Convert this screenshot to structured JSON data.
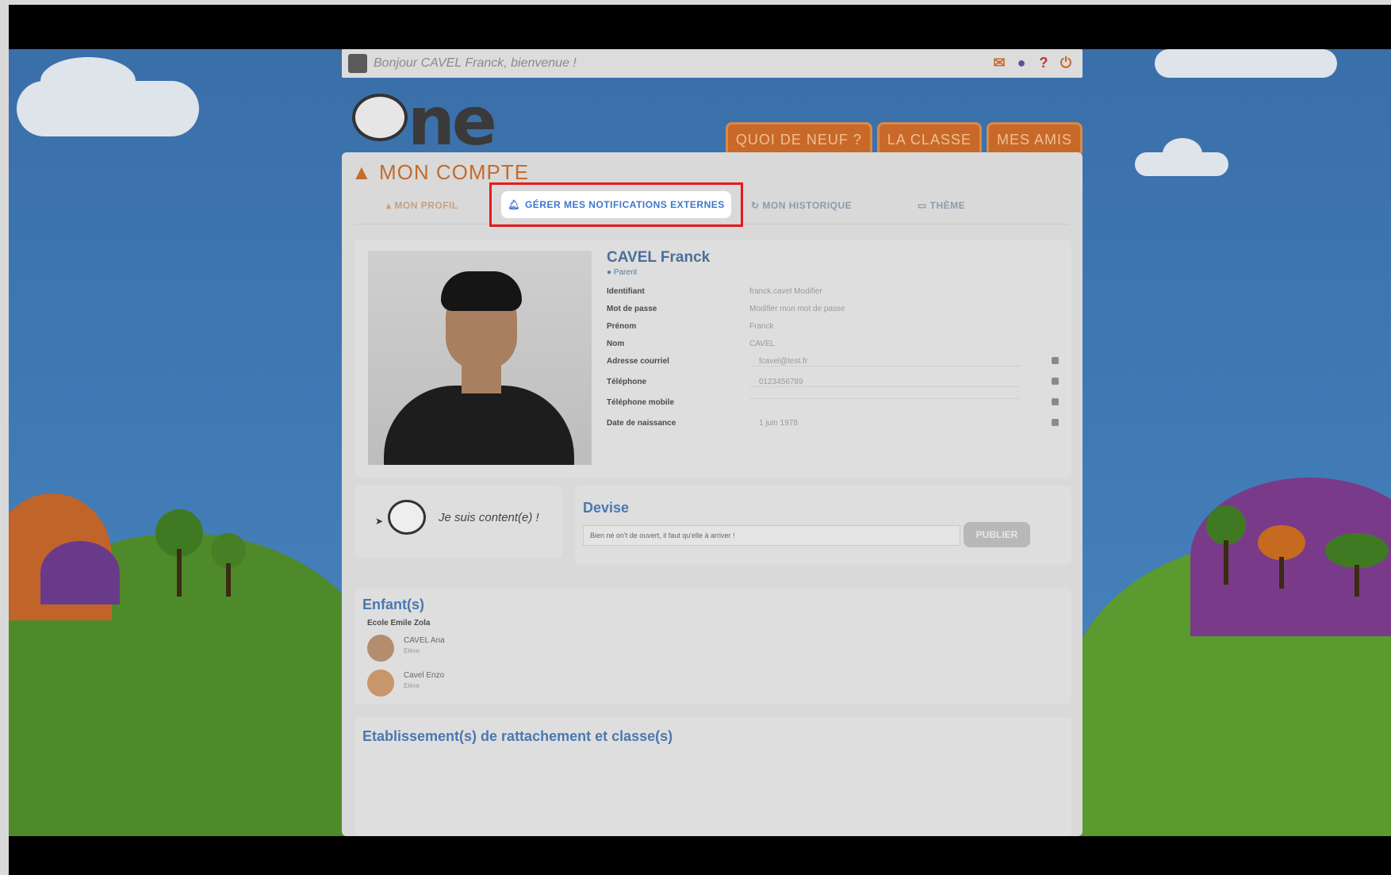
{
  "topbar": {
    "greeting": "Bonjour CAVEL Franck, bienvenue !",
    "icons": [
      "mail-icon",
      "user-circle-icon",
      "help-icon",
      "power-icon"
    ]
  },
  "logo": {
    "text_main": "ne",
    "text_e": "e"
  },
  "nav": {
    "quoi_de_neuf": "QUOI DE NEUF ?",
    "la_classe": "LA CLASSE",
    "mes_amis": "MES AMIS"
  },
  "account": {
    "title": "MON COMPTE",
    "tabs": {
      "profil": "MON PROFIL",
      "notifications": "GÉRER MES NOTIFICATIONS EXTERNES",
      "historique": "MON HISTORIQUE",
      "theme": "THÈME"
    }
  },
  "profile": {
    "name": "CAVEL Franck",
    "role": "Parent",
    "fields": [
      {
        "label": "Identifiant",
        "value": "franck.cavel Modifier"
      },
      {
        "label": "Mot de passe",
        "value": "Modifier mon mot de passe"
      },
      {
        "label": "Prénom",
        "value": "Franck"
      },
      {
        "label": "Nom",
        "value": "CAVEL"
      },
      {
        "label": "Adresse courriel",
        "value": "fcavel@test.fr"
      },
      {
        "label": "Téléphone",
        "value": "0123456789"
      },
      {
        "label": "Téléphone mobile",
        "value": ""
      },
      {
        "label": "Date de naissance",
        "value": "1 juin 1978"
      }
    ]
  },
  "mood": {
    "text": "Je suis content(e) !"
  },
  "devise": {
    "title": "Devise",
    "value": "Bien né on't de ouvert, il faut qu'elle à arriver !",
    "button": "PUBLIER"
  },
  "children": {
    "title": "Enfant(s)",
    "school": "Ecole Emile Zola",
    "items": [
      {
        "name": "CAVEL Ana",
        "sub": "Elève"
      },
      {
        "name": "Cavel Enzo",
        "sub": "Elève"
      }
    ]
  },
  "etablissement": {
    "title": "Etablissement(s) de rattachement et classe(s)"
  },
  "colors": {
    "accent_orange": "#c8692a",
    "link_blue": "#3d77c9",
    "highlight_red": "#e41b1b"
  }
}
